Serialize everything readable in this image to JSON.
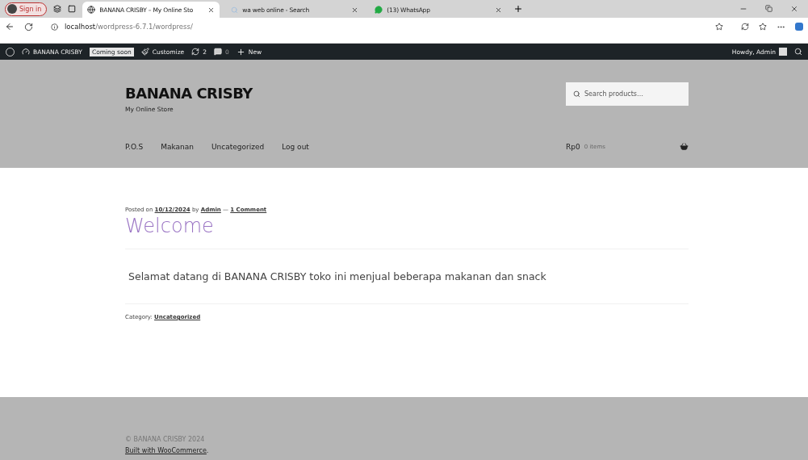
{
  "browser": {
    "profile": "Sign in",
    "tabs": [
      {
        "title": "BANANA CRISBY – My Online Sto",
        "selected": true,
        "kind": "globe"
      },
      {
        "title": "wa web online - Search",
        "selected": false,
        "kind": "search"
      },
      {
        "title": "(13) WhatsApp",
        "selected": false,
        "kind": "chat"
      }
    ],
    "address": {
      "host": "localhost",
      "path": "/wordpress-6.7.1/wordpress/"
    }
  },
  "admin_bar": {
    "site": "BANANA CRISBY",
    "badge": "Coming soon",
    "customize": "Customize",
    "updates": "2",
    "comments": "0",
    "new": "New",
    "greeting": "Howdy, Admin"
  },
  "header": {
    "title": "BANANA CRISBY",
    "tagline": "My Online Store",
    "search": {
      "placeholder": "Search products…"
    },
    "menu": [
      "P.O.S",
      "Makanan",
      "Uncategorized",
      "Log out"
    ],
    "cart": {
      "amount": "Rp0",
      "items": "0 items"
    }
  },
  "post": {
    "posted_on": "Posted on",
    "date": "10/12/2024",
    "by": "by",
    "author": "Admin",
    "sep": "—",
    "comments": "1 Comment",
    "title": "Welcome",
    "body": "Selamat datang di BANANA CRISBY toko ini menjual beberapa makanan dan snack",
    "category_label": "Category:",
    "category": "Uncategorized"
  },
  "footer": {
    "copyright": "© BANANA CRISBY 2024",
    "link": "Built with WooCommerce",
    "after": "."
  }
}
